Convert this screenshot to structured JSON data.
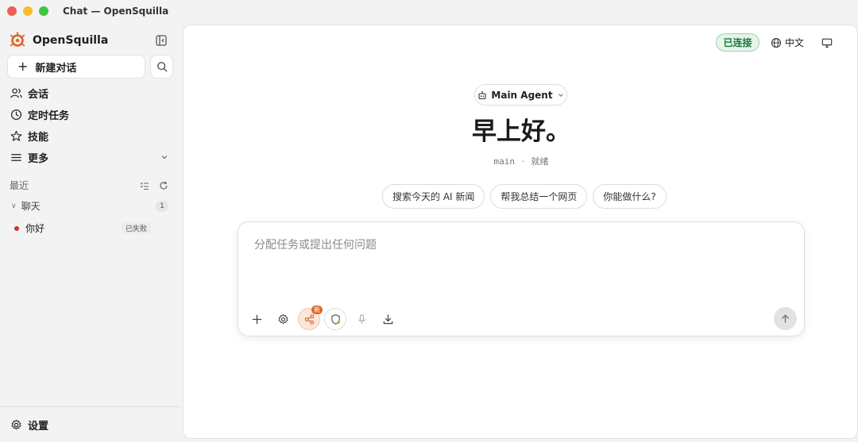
{
  "window": {
    "title": "Chat — OpenSquilla"
  },
  "sidebar": {
    "brand": "OpenSquilla",
    "new_chat_label": "新建对话",
    "nav": [
      {
        "label": "会话",
        "icon": "users-icon"
      },
      {
        "label": "定时任务",
        "icon": "clock-icon"
      },
      {
        "label": "技能",
        "icon": "star-icon"
      },
      {
        "label": "更多",
        "icon": "menu-icon"
      }
    ],
    "recent_label": "最近",
    "group": {
      "label": "聊天",
      "count": "1"
    },
    "chats": [
      {
        "title": "你好",
        "status": "已失败",
        "status_color": "#c8362c"
      }
    ],
    "settings_label": "设置"
  },
  "header": {
    "connection_status": "已连接",
    "language": "中文"
  },
  "main": {
    "agent_label": "Main Agent",
    "greeting": "早上好。",
    "agent_id": "main",
    "separator": "·",
    "agent_state": "就绪",
    "suggestions": [
      "搜索今天的 AI 新闻",
      "帮我总结一个网页",
      "你能做什么?"
    ],
    "composer": {
      "placeholder": "分配任务或提出任何问题",
      "value": "",
      "new_badge": "新"
    }
  },
  "colors": {
    "accent": "#e0682b",
    "connected_bg": "#e6f4ea",
    "connected_text": "#1b7a3a"
  }
}
